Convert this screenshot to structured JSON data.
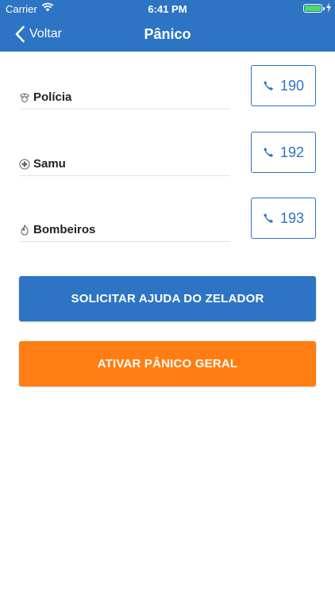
{
  "status_bar": {
    "carrier": "Carrier",
    "time": "6:41 PM",
    "battery_color": "#4cd964"
  },
  "nav": {
    "back_label": "Voltar",
    "title": "Pânico"
  },
  "emergency_contacts": [
    {
      "name": "Polícia",
      "number": "190",
      "icon": "police-icon"
    },
    {
      "name": "Samu",
      "number": "192",
      "icon": "medical-cross-icon"
    },
    {
      "name": "Bombeiros",
      "number": "193",
      "icon": "flame-icon"
    }
  ],
  "actions": {
    "request_help_label": "SOLICITAR AJUDA DO ZELADOR",
    "panic_label": "ATIVAR PÂNICO GERAL"
  },
  "colors": {
    "brand_blue": "#2d74c4",
    "panic_orange": "#ff7d12"
  }
}
